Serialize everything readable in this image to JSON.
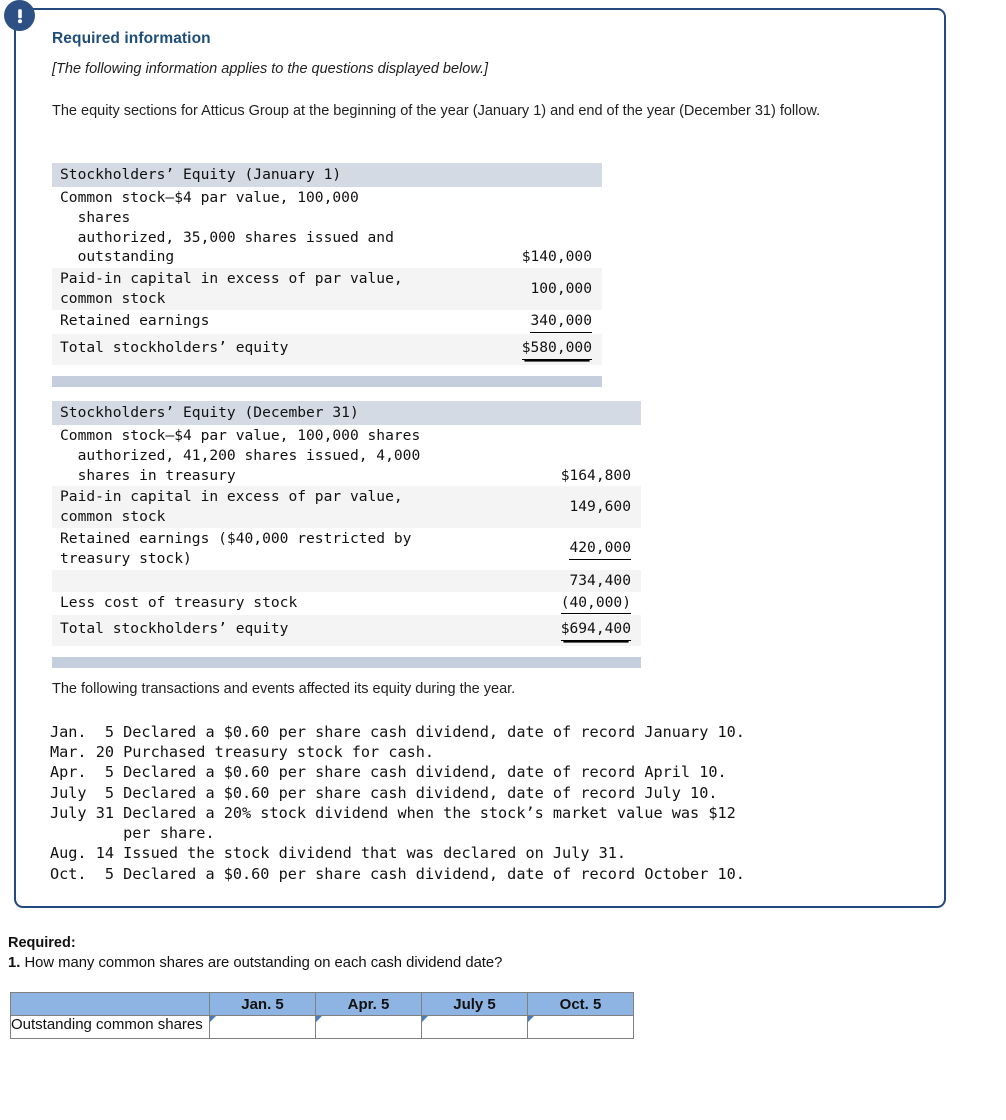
{
  "callout": {
    "icon": "exclamation-icon",
    "heading": "Required information",
    "note": "[The following information applies to the questions displayed below.]",
    "intro": "The equity sections for Atticus Group at the beginning of the year (January 1) and end of the year (December 31) follow."
  },
  "equity_january": {
    "title": "Stockholders’ Equity (January 1)",
    "rows": [
      {
        "label": "Common stock—$4 par value, 100,000\n  shares\n  authorized, 35,000 shares issued and\n  outstanding",
        "amount": "$140,000"
      },
      {
        "label": "Paid-in capital in excess of par value,\ncommon stock",
        "amount": "100,000"
      },
      {
        "label": "Retained earnings",
        "amount": "340,000"
      },
      {
        "label": "Total stockholders’ equity",
        "amount": "$580,000"
      }
    ]
  },
  "equity_december": {
    "title": "Stockholders’ Equity (December 31)",
    "rows": [
      {
        "label": "Common stock—$4 par value, 100,000 shares\n  authorized, 41,200 shares issued, 4,000\n  shares in treasury",
        "amount": "$164,800"
      },
      {
        "label": "Paid-in capital in excess of par value,\ncommon stock",
        "amount": "149,600"
      },
      {
        "label": "Retained earnings ($40,000 restricted by\ntreasury stock)",
        "amount": "420,000"
      },
      {
        "label": "",
        "amount": "734,400"
      },
      {
        "label": "Less cost of treasury stock",
        "amount": "(40,000)"
      },
      {
        "label": "Total stockholders’ equity",
        "amount": "$694,400"
      }
    ]
  },
  "transactions": {
    "intro": "The following transactions and events affected its equity during the year.",
    "lines": "Jan.  5 Declared a $0.60 per share cash dividend, date of record January 10.\nMar. 20 Purchased treasury stock for cash.\nApr.  5 Declared a $0.60 per share cash dividend, date of record April 10.\nJuly  5 Declared a $0.60 per share cash dividend, date of record July 10.\nJuly 31 Declared a 20% stock dividend when the stock’s market value was $12\n        per share.\nAug. 14 Issued the stock dividend that was declared on July 31.\nOct.  5 Declared a $0.60 per share cash dividend, date of record October 10."
  },
  "required": {
    "label": "Required:",
    "number": "1.",
    "question": "How many common shares are outstanding on each cash dividend date?"
  },
  "answer_table": {
    "corner": "",
    "columns": [
      "Jan. 5",
      "Apr. 5",
      "July 5",
      "Oct. 5"
    ],
    "row_label": "Outstanding common shares",
    "values": [
      "",
      "",
      "",
      ""
    ]
  },
  "colors": {
    "callout_border": "#24497f",
    "heading_blue": "#1f4e79",
    "icon_navy": "#2d5185",
    "table_header_band": "#d4dae4",
    "table_stripe": "#f4f4f4",
    "table_footer_band": "#c5cedd",
    "answer_header_blue": "#8db4e2",
    "answer_input_border": "#4a7ebb"
  }
}
